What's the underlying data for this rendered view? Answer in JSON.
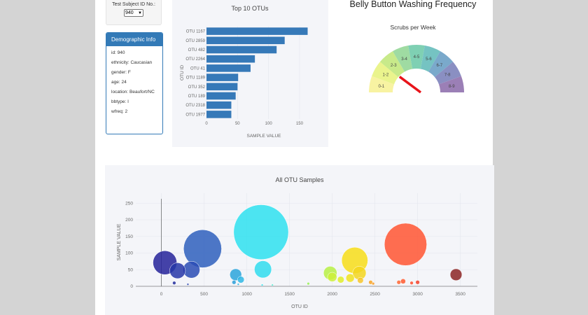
{
  "selector": {
    "label": "Test Subject ID No.:",
    "value": "940"
  },
  "demographic": {
    "title": "Demographic Info",
    "lines": [
      "id: 940",
      "ethnicity: Caucasian",
      "gender: F",
      "age: 24",
      "location: Beaufort/NC",
      "bbtype: I",
      "wfreq: 2"
    ]
  },
  "bar_chart": {
    "title": "Top 10 OTUs",
    "xlabel": "SAMPLE VALUE",
    "ylabel": "OTU ID",
    "ticks": [
      "0",
      "50",
      "100",
      "150"
    ],
    "bar_color": "#3679b8"
  },
  "gauge": {
    "title": "Belly Button Washing Frequency",
    "subtitle": "Scrubs per Week",
    "segments": [
      "0-1",
      "1-2",
      "2-3",
      "3-4",
      "4-5",
      "5-6",
      "6-7",
      "7-8",
      "8-9"
    ],
    "colors": [
      "#f8f3a2",
      "#eaf48d",
      "#c8ea8a",
      "#9fdba2",
      "#7fd0b3",
      "#75c3c2",
      "#7aa9cb",
      "#8a8fc2",
      "#9b7fb6"
    ],
    "needle_value": 2,
    "needle_color": "#e8141a"
  },
  "bubble_chart": {
    "title": "All OTU Samples",
    "xlabel": "OTU ID",
    "ylabel": "SAMPLE VALUE",
    "xticks": [
      "0",
      "500",
      "1000",
      "1500",
      "2000",
      "2500",
      "3000",
      "3500"
    ],
    "yticks": [
      "0",
      "50",
      "100",
      "150",
      "200",
      "250"
    ]
  },
  "chart_data": [
    {
      "type": "bar",
      "title": "Top 10 OTUs",
      "xlabel": "SAMPLE VALUE",
      "ylabel": "OTU ID",
      "categories": [
        "OTU 1167",
        "OTU 2859",
        "OTU 482",
        "OTU 2264",
        "OTU 41",
        "OTU 1189",
        "OTU 352",
        "OTU 189",
        "OTU 2318",
        "OTU 1977"
      ],
      "values": [
        163,
        126,
        113,
        78,
        71,
        51,
        50,
        47,
        40,
        40
      ],
      "xlim": [
        0,
        185
      ]
    },
    {
      "type": "scatter",
      "title": "All OTU Samples",
      "xlabel": "OTU ID",
      "ylabel": "SAMPLE VALUE",
      "xlim": [
        -300,
        3700
      ],
      "ylim": [
        0,
        280
      ],
      "points": [
        {
          "x": 1167,
          "y": 163,
          "size": 163,
          "color": "#2ee0f0"
        },
        {
          "x": 2859,
          "y": 126,
          "size": 126,
          "color": "#ff5533"
        },
        {
          "x": 482,
          "y": 113,
          "size": 113,
          "color": "#2e5fbd"
        },
        {
          "x": 2264,
          "y": 78,
          "size": 78,
          "color": "#f7dd19"
        },
        {
          "x": 41,
          "y": 71,
          "size": 71,
          "color": "#25229a"
        },
        {
          "x": 1189,
          "y": 51,
          "size": 51,
          "color": "#30dcef"
        },
        {
          "x": 352,
          "y": 50,
          "size": 50,
          "color": "#2a4cb5"
        },
        {
          "x": 189,
          "y": 47,
          "size": 47,
          "color": "#2636a8"
        },
        {
          "x": 2318,
          "y": 40,
          "size": 40,
          "color": "#f3d61f"
        },
        {
          "x": 1977,
          "y": 40,
          "size": 40,
          "color": "#b7f046"
        },
        {
          "x": 3450,
          "y": 35,
          "size": 35,
          "color": "#8b2424"
        },
        {
          "x": 870,
          "y": 35,
          "size": 35,
          "color": "#2aa4dc"
        },
        {
          "x": 2210,
          "y": 25,
          "size": 25,
          "color": "#f0e21e"
        },
        {
          "x": 2000,
          "y": 28,
          "size": 28,
          "color": "#cdf03a"
        },
        {
          "x": 2100,
          "y": 20,
          "size": 20,
          "color": "#dfed2a"
        },
        {
          "x": 930,
          "y": 20,
          "size": 20,
          "color": "#2fb7e5"
        },
        {
          "x": 2330,
          "y": 18,
          "size": 18,
          "color": "#f7c52a"
        },
        {
          "x": 2450,
          "y": 12,
          "size": 12,
          "color": "#f8a323"
        },
        {
          "x": 2480,
          "y": 8,
          "size": 8,
          "color": "#f79a22"
        },
        {
          "x": 2780,
          "y": 12,
          "size": 12,
          "color": "#ff6633"
        },
        {
          "x": 2830,
          "y": 15,
          "size": 15,
          "color": "#ff5a30"
        },
        {
          "x": 2930,
          "y": 10,
          "size": 10,
          "color": "#ff4d2e"
        },
        {
          "x": 3000,
          "y": 12,
          "size": 12,
          "color": "#f3412a"
        },
        {
          "x": 1720,
          "y": 8,
          "size": 8,
          "color": "#95ee55"
        },
        {
          "x": 1300,
          "y": 4,
          "size": 4,
          "color": "#56e8d2"
        },
        {
          "x": 1180,
          "y": 4,
          "size": 4,
          "color": "#2fe0ef"
        },
        {
          "x": 850,
          "y": 12,
          "size": 12,
          "color": "#2a9fd9"
        },
        {
          "x": 900,
          "y": 6,
          "size": 6,
          "color": "#2eb1e2"
        },
        {
          "x": 150,
          "y": 10,
          "size": 10,
          "color": "#222d9e"
        },
        {
          "x": 310,
          "y": 6,
          "size": 6,
          "color": "#2844b0"
        }
      ]
    }
  ]
}
